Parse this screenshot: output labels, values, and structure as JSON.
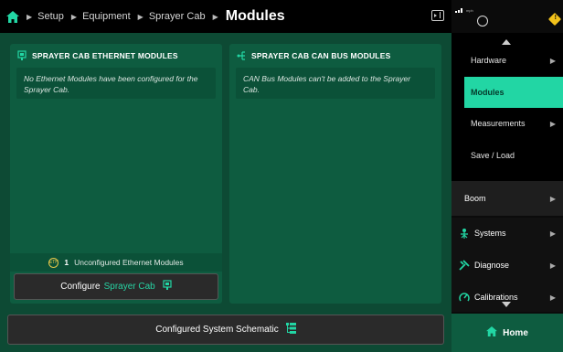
{
  "breadcrumb": {
    "items": [
      "Setup",
      "Equipment",
      "Sprayer Cab"
    ],
    "current": "Modules"
  },
  "left_card": {
    "title": "SPRAYER CAB ETHERNET MODULES",
    "message": "No Ethernet Modules have been configured for the Sprayer Cab.",
    "unconfigured_count": "1",
    "unconfigured_label": "Unconfigured Ethernet Modules",
    "badge_text": "ETH",
    "configure_prefix": "Configure",
    "configure_target": "Sprayer Cab"
  },
  "right_card": {
    "title": "SPRAYER CAB CAN BUS MODULES",
    "message": "CAN Bus Modules can't be added to the Sprayer Cab."
  },
  "schematic_button": "Configured System Schematic",
  "status": {
    "speed_unit": "mph",
    "warning_symbol": "!"
  },
  "submenu": {
    "items": [
      {
        "label": "Hardware",
        "active": false
      },
      {
        "label": "Modules",
        "active": true
      },
      {
        "label": "Measurements",
        "active": false
      },
      {
        "label": "Save / Load",
        "active": false
      }
    ]
  },
  "boom_label": "Boom",
  "mainmenu": {
    "items": [
      {
        "label": "Systems",
        "icon": "systems-icon"
      },
      {
        "label": "Diagnose",
        "icon": "diagnose-icon"
      },
      {
        "label": "Calibrations",
        "icon": "calibrations-icon"
      }
    ]
  },
  "home_label": "Home",
  "colors": {
    "accent": "#22d6a4",
    "panel": "#0e5c40",
    "background": "#0d4a34",
    "warning": "#f2c21b"
  }
}
